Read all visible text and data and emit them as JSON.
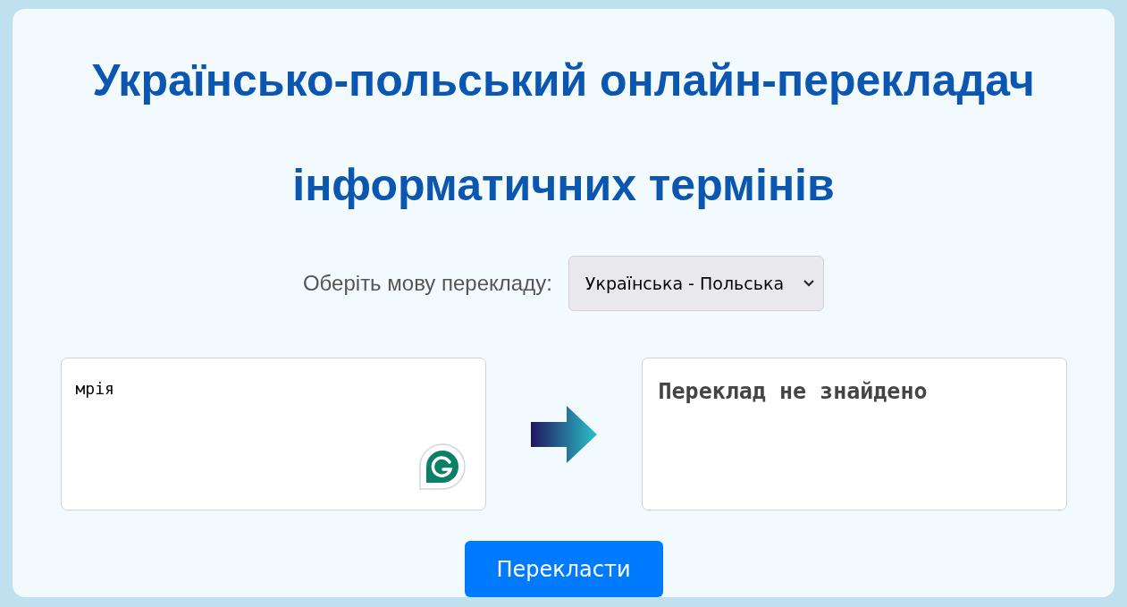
{
  "title": "Українсько-польський онлайн-перекладач інформатичних термінів",
  "language_select": {
    "label": "Оберіть мову перекладу:",
    "value": "Українська - Польська"
  },
  "input": {
    "value": "мрія"
  },
  "output": {
    "text": "Переклад не знайдено"
  },
  "button": {
    "label": "Перекласти"
  }
}
